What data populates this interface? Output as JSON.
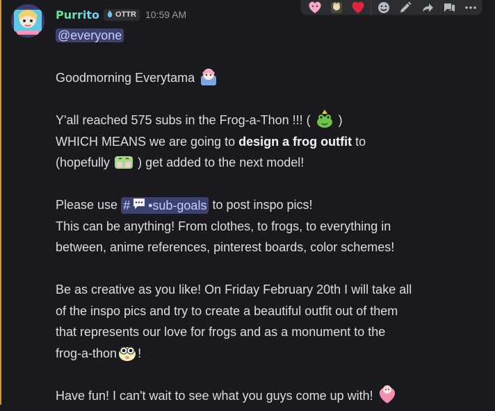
{
  "message": {
    "author": "Purrito",
    "badge": "OTTR",
    "timestamp": "10:59 AM",
    "mention": "@everyone",
    "greeting": "Goodmorning Everytama",
    "p1_line1_a": "Y'all reached 575 subs in the Frog-a-Thon !!! (",
    "p1_line1_b": ")",
    "p1_line2_a": "WHICH MEANS we are going to ",
    "p1_line2_bold": "design a frog outfit",
    "p1_line2_b": " to",
    "p1_line3_a": "(hopefully",
    "p1_line3_b": ") get added to the next model!",
    "p2_line1_a": "Please use",
    "p2_line1_b": "to post inspo pics!",
    "channel_hash": "#",
    "channel_name": "•sub-goals",
    "p2_line2": "This can be anything! From clothes, to frogs, to everything in",
    "p2_line3": "between, anime references, pinterest boards, color schemes!",
    "p3_line1": "Be as creative as you like! On Friday February 20th I will take all",
    "p3_line2": "of the inspo pics and try to create a beautiful outfit out of them",
    "p3_line3": "that represents our love for frogs and as a monument to the",
    "p3_line4_a": "frog-a-thon",
    "p3_line4_b": "!",
    "p4_line1": "Have fun! I can't wait to see what you guys come up with!"
  },
  "toolbar": {
    "icons": [
      "pink-heart-reaction-icon",
      "chibi-reaction-icon",
      "red-heart-reaction-icon",
      "add-reaction-icon",
      "edit-icon",
      "forward-icon",
      "thread-icon",
      "more-icon"
    ]
  },
  "colors": {
    "background": "#1a1a1e",
    "text": "#dbdee1",
    "mention_bg": "#3c4270",
    "mention_text": "#c9cdfb",
    "mention_bar": "#c99a3a",
    "timestamp": "#949ba4"
  }
}
